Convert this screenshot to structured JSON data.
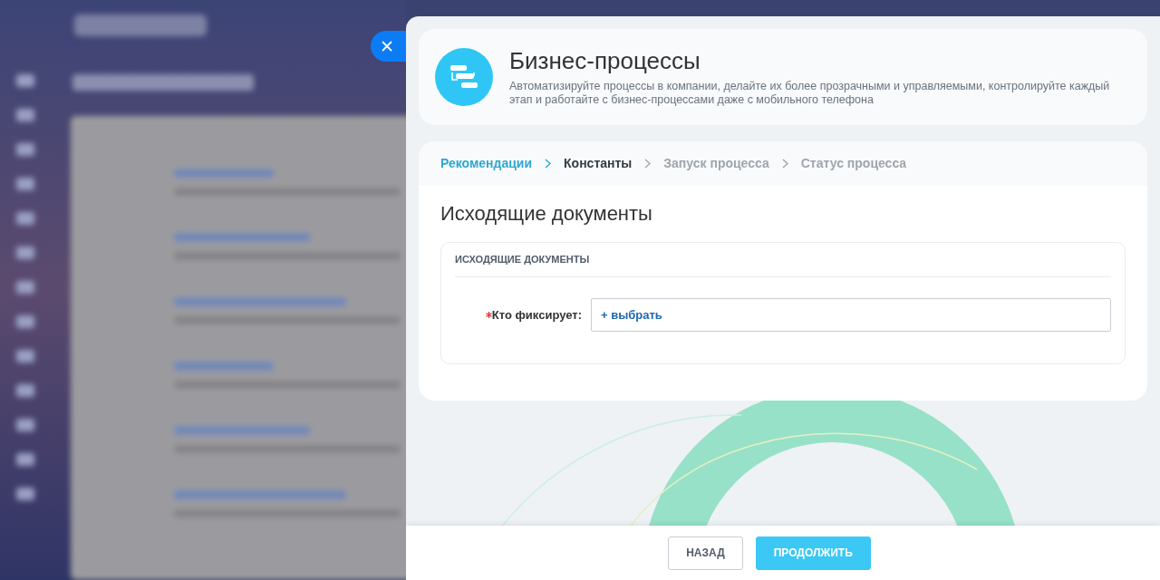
{
  "header": {
    "title": "Бизнес-процессы",
    "description": "Автоматизируйте процессы в компании, делайте их более прозрачными и управляемыми, контролируйте каждый этап и работайте с бизнес-процессами даже с мобильного телефона"
  },
  "steps": [
    {
      "label": "Рекомендации",
      "completed": true,
      "selected": false
    },
    {
      "label": "Константы",
      "completed": false,
      "selected": true
    },
    {
      "label": "Запуск процесса",
      "completed": false,
      "selected": false
    },
    {
      "label": "Статус процесса",
      "completed": false,
      "selected": false
    }
  ],
  "section_title": "Исходящие документы",
  "group": {
    "title": "ИСХОДЯЩИЕ ДОКУМЕНТЫ",
    "fields": [
      {
        "label": "Кто фиксирует:",
        "required": true,
        "value": "+ выбрать"
      }
    ]
  },
  "buttons": [
    {
      "label": "НАЗАД",
      "kind": "secondary"
    },
    {
      "label": "ПРОДОЛЖИТЬ",
      "kind": "primary"
    }
  ]
}
